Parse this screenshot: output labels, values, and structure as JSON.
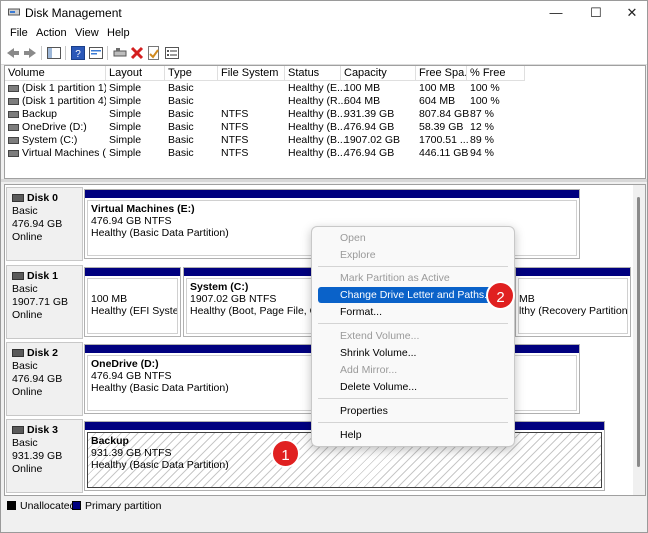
{
  "window": {
    "title": "Disk Management",
    "controls": {
      "minimize": "—",
      "maximize": "☐",
      "close": "✕"
    }
  },
  "menu": [
    "File",
    "Action",
    "View",
    "Help"
  ],
  "toolbar_icons": [
    "back-icon",
    "forward-icon",
    "console-tree-icon",
    "help-icon",
    "properties-icon",
    "connect-icon",
    "delete-icon",
    "check-icon",
    "list-icon"
  ],
  "volumes": {
    "headers": [
      "Volume",
      "Layout",
      "Type",
      "File System",
      "Status",
      "Capacity",
      "Free Spa...",
      "% Free"
    ],
    "rows": [
      [
        "(Disk 1 partition 1)",
        "Simple",
        "Basic",
        "",
        "Healthy (E...",
        "100 MB",
        "100 MB",
        "100 %"
      ],
      [
        "(Disk 1 partition 4)",
        "Simple",
        "Basic",
        "",
        "Healthy (R...",
        "604 MB",
        "604 MB",
        "100 %"
      ],
      [
        "Backup",
        "Simple",
        "Basic",
        "NTFS",
        "Healthy (B...",
        "931.39 GB",
        "807.84 GB",
        "87 %"
      ],
      [
        "OneDrive (D:)",
        "Simple",
        "Basic",
        "NTFS",
        "Healthy (B...",
        "476.94 GB",
        "58.39 GB",
        "12 %"
      ],
      [
        "System (C:)",
        "Simple",
        "Basic",
        "NTFS",
        "Healthy (B...",
        "1907.02 GB",
        "1700.51 ...",
        "89 %"
      ],
      [
        "Virtual Machines (...",
        "Simple",
        "Basic",
        "NTFS",
        "Healthy (B...",
        "476.94 GB",
        "446.11 GB",
        "94 %"
      ]
    ]
  },
  "disks": [
    {
      "name": "Disk 0",
      "type": "Basic",
      "size": "476.94 GB",
      "state": "Online",
      "partitions": [
        {
          "name": "Virtual Machines  (E:)",
          "size": "476.94 GB NTFS",
          "status": "Healthy (Basic Data Partition)"
        }
      ]
    },
    {
      "name": "Disk 1",
      "type": "Basic",
      "size": "1907.71 GB",
      "state": "Online",
      "partitions": [
        {
          "name": "",
          "size": "100 MB",
          "status": "Healthy (EFI System P"
        },
        {
          "name": "System  (C:)",
          "size": "1907.02 GB NTFS",
          "status": "Healthy (Boot, Page File, Crash"
        },
        {
          "name": "",
          "size": "MB",
          "status": "lthy (Recovery Partition)"
        }
      ]
    },
    {
      "name": "Disk 2",
      "type": "Basic",
      "size": "476.94 GB",
      "state": "Online",
      "partitions": [
        {
          "name": "OneDrive  (D:)",
          "size": "476.94 GB NTFS",
          "status": "Healthy (Basic Data Partition)"
        }
      ]
    },
    {
      "name": "Disk 3",
      "type": "Basic",
      "size": "931.39 GB",
      "state": "Online",
      "partitions": [
        {
          "name": "Backup",
          "size": "931.39 GB NTFS",
          "status": "Healthy (Basic Data Partition)"
        }
      ]
    }
  ],
  "legend": [
    "Unallocated",
    "Primary partition"
  ],
  "context_menu": [
    {
      "label": "Open",
      "enabled": false
    },
    {
      "label": "Explore",
      "enabled": false
    },
    {
      "label": "Mark Partition as Active",
      "enabled": false
    },
    {
      "label": "Change Drive Letter and Paths...",
      "enabled": true,
      "highlighted": true
    },
    {
      "label": "Format...",
      "enabled": true
    },
    {
      "label": "Extend Volume...",
      "enabled": false
    },
    {
      "label": "Shrink Volume...",
      "enabled": true
    },
    {
      "label": "Add Mirror...",
      "enabled": false
    },
    {
      "label": "Delete Volume...",
      "enabled": true
    },
    {
      "label": "Properties",
      "enabled": true
    },
    {
      "label": "Help",
      "enabled": true
    }
  ],
  "callouts": [
    "1",
    "2"
  ],
  "colors": {
    "primary_partition": "#00007f",
    "highlight": "#0a62c9",
    "callout": "#e02020"
  }
}
